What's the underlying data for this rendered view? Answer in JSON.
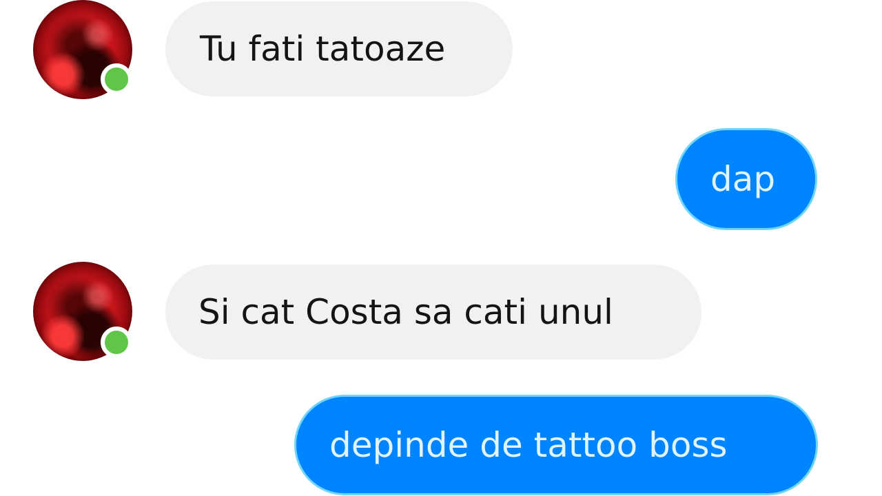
{
  "conversation": {
    "messages": [
      {
        "sender": "contact",
        "text": "Tu fati tatoaze",
        "has_avatar": true,
        "online": true
      },
      {
        "sender": "self",
        "text": "dap"
      },
      {
        "sender": "contact",
        "text": "Si cat Costa sa cati unul",
        "has_avatar": true,
        "online": true
      },
      {
        "sender": "self",
        "text": "depinde de tattoo boss"
      }
    ]
  },
  "colors": {
    "incoming_bubble": "#f1f1f2",
    "incoming_text": "#141414",
    "outgoing_bubble": "#0084ff",
    "outgoing_text": "#dff4ff",
    "presence_online": "#5fc64a",
    "background": "#ffffff"
  },
  "icons": {
    "avatar": "contact-avatar-icon",
    "presence": "online-status-dot-icon"
  }
}
